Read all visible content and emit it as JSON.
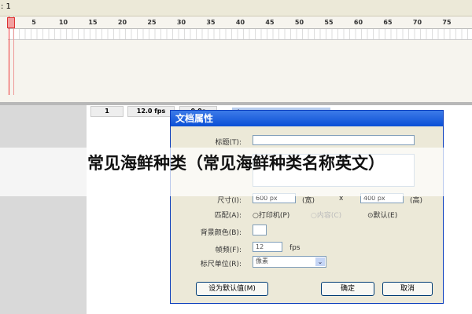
{
  "topbar": {
    "scene": ": 1"
  },
  "timeline": {
    "ruler_ticks": [
      "1",
      "5",
      "10",
      "15",
      "20",
      "25",
      "30",
      "35",
      "40",
      "45",
      "50",
      "55",
      "60",
      "65",
      "70",
      "75"
    ],
    "current_frame": "1",
    "frame_rate": "12.0 fps",
    "elapsed": "0.0s"
  },
  "dialog": {
    "title": "文档属性",
    "title_label": "标题(T):",
    "size_label": "尺寸(I):",
    "width": "600 px",
    "width_unit": "(宽)",
    "times": "x",
    "height": "400 px",
    "height_unit": "(高)",
    "match_label": "匹配(A):",
    "match_options": [
      "打印机(P)",
      "内容(C)",
      "默认(E)"
    ],
    "match_selected": "默认(E)",
    "bg_label": "背景颜色(B):",
    "fps_label": "帧频(F):",
    "fps_value": "12",
    "fps_unit": "fps",
    "ruler_label": "标尺单位(R):",
    "ruler_value": "像素",
    "default_button": "设为默认值(M)",
    "ok_button": "确定",
    "cancel_button": "取消"
  },
  "headline": "常见海鲜种类（常见海鲜种类名称英文）"
}
